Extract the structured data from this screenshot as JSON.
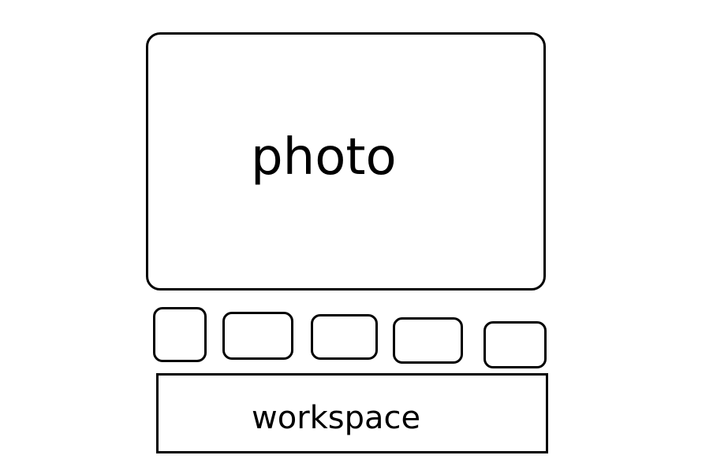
{
  "diagram": {
    "photo_label": "photo",
    "workspace_label": "workspace",
    "thumbnail_count": 5
  },
  "colors": {
    "stroke": "#000000",
    "background": "#ffffff"
  }
}
